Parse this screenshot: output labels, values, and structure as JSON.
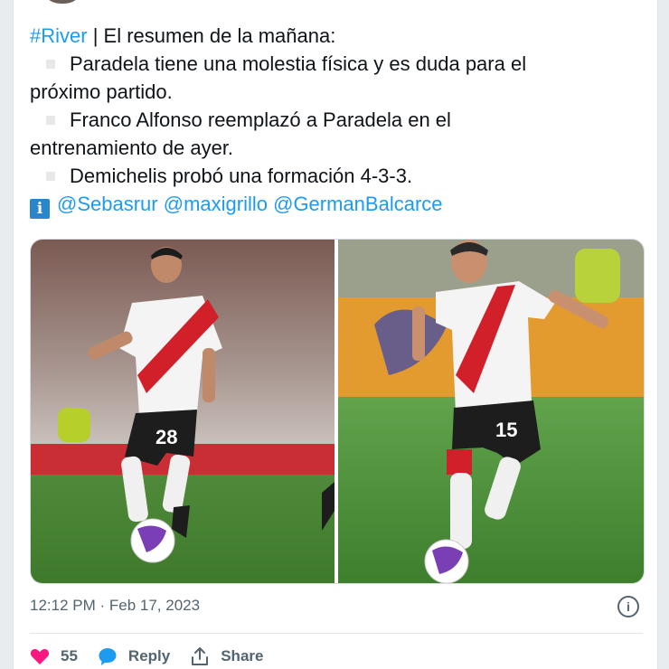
{
  "tweet": {
    "hashtag": "#River",
    "intro": " | El resumen de la mañana:",
    "bullets": [
      "Paradela tiene una molestia física y es duda para el",
      "próximo partido.",
      "Franco Alfonso reemplazó a Paradela en el",
      "entrenamiento de ayer.",
      "Demichelis probó una formación 4-3-3."
    ],
    "info_glyph": "i",
    "mentions": [
      "@Sebasrur",
      "@maxigrillo",
      "@GermanBalcarce"
    ]
  },
  "media": {
    "left_shirt_number": "28",
    "right_shirt_number": "15"
  },
  "meta": {
    "timestamp": "12:12 PM · Feb 17, 2023",
    "info_icon": "i"
  },
  "actions": {
    "likes_count": "55",
    "reply_label": "Reply",
    "share_label": "Share"
  },
  "colors": {
    "link": "#1d9bf0",
    "like": "#f91880",
    "reply_icon": "#1d9bf0",
    "meta_text": "#536471"
  },
  "icons": [
    "info-square-icon",
    "info-circle-icon",
    "heart-icon",
    "reply-bubble-icon",
    "share-icon"
  ]
}
